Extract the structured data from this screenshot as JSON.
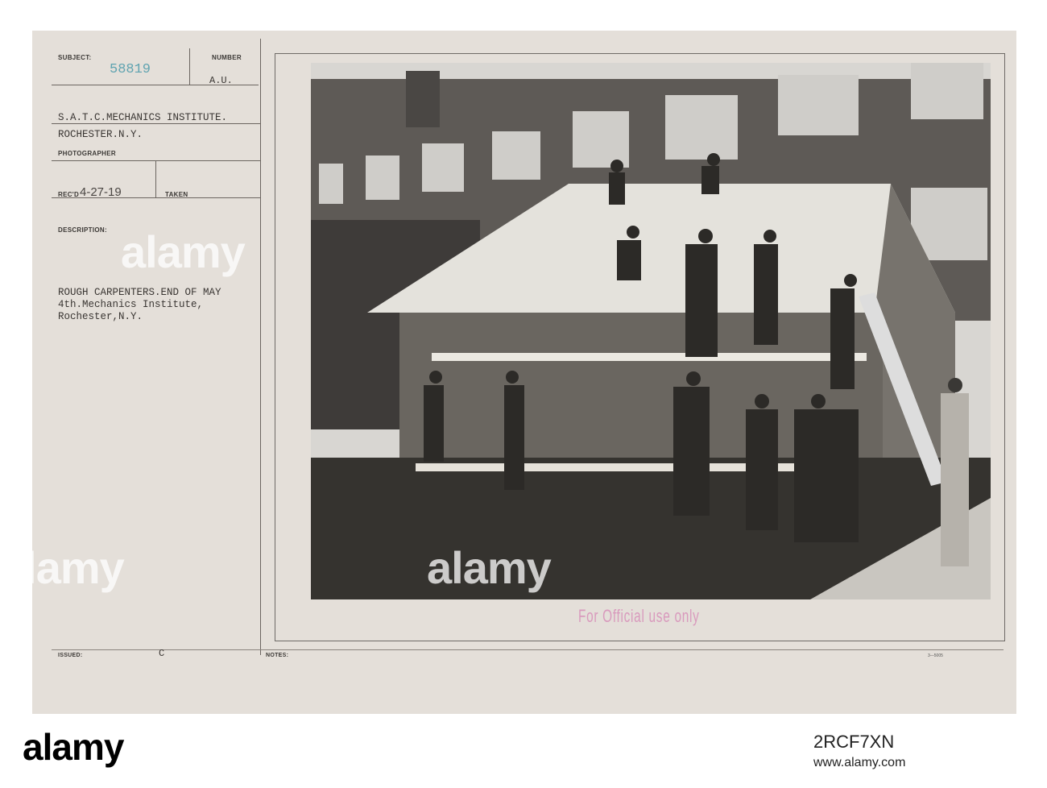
{
  "card": {
    "subject_label": "SUBJECT:",
    "subject_number": "58819",
    "number_label": "NUMBER",
    "number_value": "A.U.",
    "location_line1": "S.A.T.C.MECHANICS INSTITUTE.",
    "location_line2": "ROCHESTER.N.Y.",
    "photographer_label": "PHOTOGRAPHER",
    "recd_label": "REC'D",
    "recd_date": "4-27-19",
    "taken_label": "TAKEN",
    "description_label": "DESCRIPTION:",
    "description_lines": [
      "ROUGH CARPENTERS.END OF MAY",
      "4th.Mechanics Institute,",
      "Rochester,N.Y."
    ],
    "issued_label": "ISSUED:",
    "issued_value": "C",
    "notes_label": "NOTES:",
    "form_number": "3—5005",
    "stamp": "For Official use only"
  },
  "watermark": "alamy",
  "footer": {
    "logo": "alamy",
    "image_id": "2RCF7XN",
    "site": "www.alamy.com"
  },
  "colors": {
    "card": "#e4dfd9",
    "stamp": "#d99abd",
    "number": "#5fa3b0"
  }
}
